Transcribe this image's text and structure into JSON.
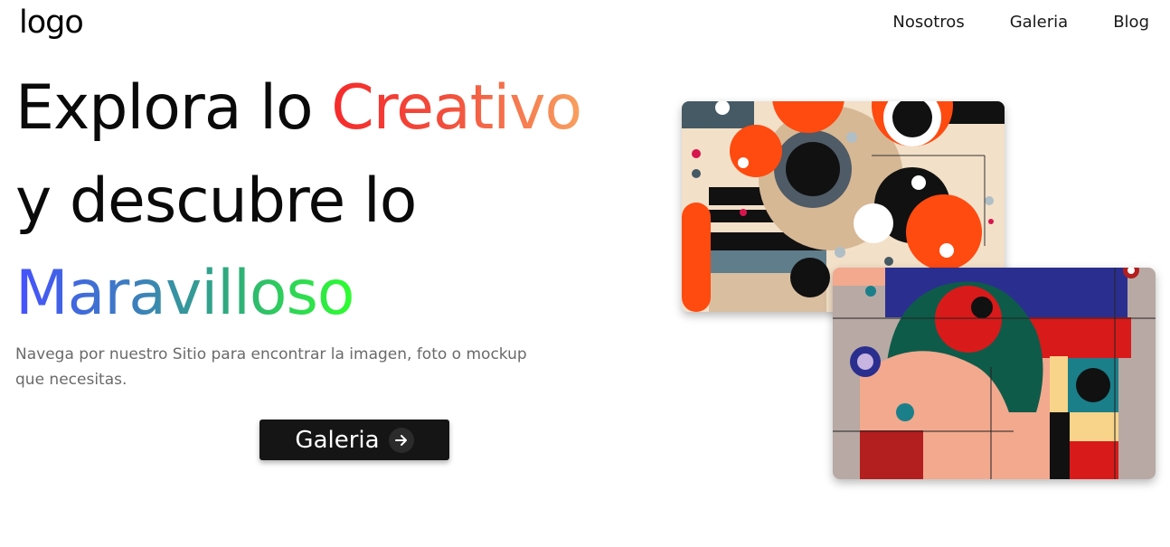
{
  "header": {
    "logo": "logo",
    "nav": [
      "Nosotros",
      "Galeria",
      "Blog"
    ]
  },
  "hero": {
    "line1_plain": "Explora lo ",
    "line1_accent": "Creativo",
    "line2": "y descubre lo",
    "line3_accent": "Maravilloso",
    "subtitle": "Navega por nuestro Sitio para encontrar la imagen, foto o mockup que necesitas.",
    "cta_label": "Galeria",
    "cta_icon": "arrow-right-icon"
  },
  "colors": {
    "warm_gradient": [
      "#f52a2a",
      "#f8a060"
    ],
    "cool_gradient": [
      "#4651ff",
      "#2eff2e"
    ],
    "cta_background": "#151515"
  }
}
